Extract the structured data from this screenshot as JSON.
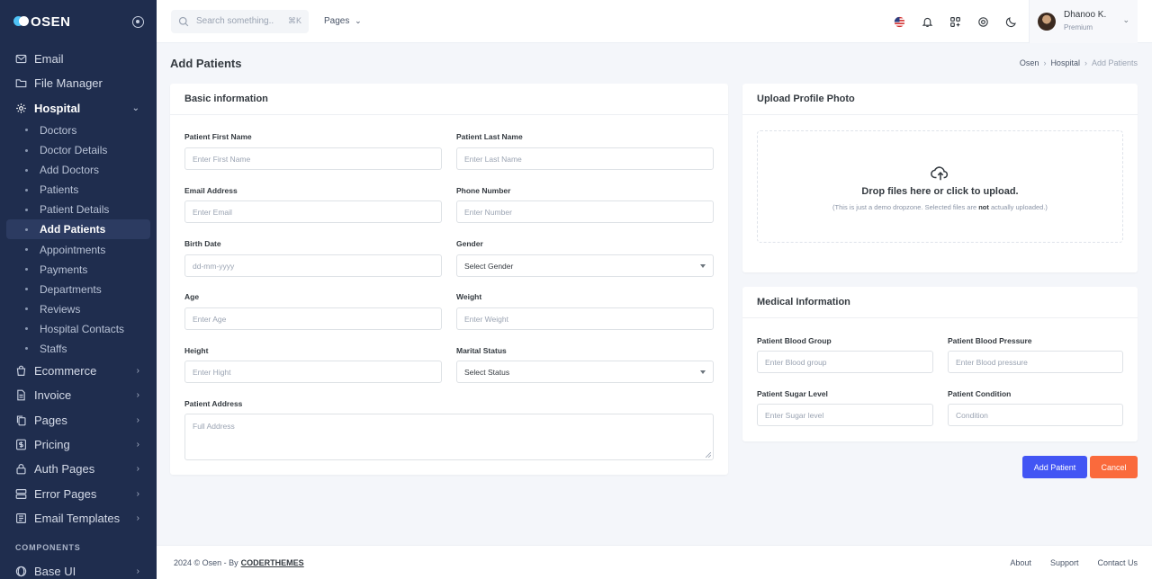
{
  "brand": {
    "name": "OSEN"
  },
  "sidebar": {
    "items": [
      {
        "label": "Email",
        "icon": "mail-icon"
      },
      {
        "label": "File Manager",
        "icon": "folder-icon"
      },
      {
        "label": "Hospital",
        "icon": "gear-icon"
      }
    ],
    "hospital_sub": [
      "Doctors",
      "Doctor Details",
      "Add Doctors",
      "Patients",
      "Patient Details",
      "Add Patients",
      "Appointments",
      "Payments",
      "Departments",
      "Reviews",
      "Hospital Contacts",
      "Staffs"
    ],
    "items2": [
      {
        "label": "Ecommerce",
        "icon": "shopping-bag-icon"
      },
      {
        "label": "Invoice",
        "icon": "file-text-icon"
      },
      {
        "label": "Pages",
        "icon": "copy-icon"
      },
      {
        "label": "Pricing",
        "icon": "dollar-icon"
      },
      {
        "label": "Auth Pages",
        "icon": "lock-icon"
      },
      {
        "label": "Error Pages",
        "icon": "server-icon"
      },
      {
        "label": "Email Templates",
        "icon": "template-icon"
      }
    ],
    "section_components": "COMPONENTS",
    "items3": [
      {
        "label": "Base UI",
        "icon": "globe-icon"
      }
    ]
  },
  "topbar": {
    "search_placeholder": "Search something..",
    "search_kbd": "⌘K",
    "pages_label": "Pages",
    "user": {
      "name": "Dhanoo K.",
      "role": "Premium"
    }
  },
  "page": {
    "title": "Add Patients",
    "breadcrumb": [
      "Osen",
      "Hospital",
      "Add Patients"
    ]
  },
  "basic": {
    "title": "Basic information",
    "first_name": {
      "label": "Patient First Name",
      "placeholder": "Enter First Name"
    },
    "last_name": {
      "label": "Patient Last Name",
      "placeholder": "Enter Last Name"
    },
    "email": {
      "label": "Email Address",
      "placeholder": "Enter Email"
    },
    "phone": {
      "label": "Phone Number",
      "placeholder": "Enter Number"
    },
    "birth": {
      "label": "Birth Date",
      "placeholder": "dd-mm-yyyy"
    },
    "gender": {
      "label": "Gender",
      "value": "Select Gender"
    },
    "age": {
      "label": "Age",
      "placeholder": "Enter Age"
    },
    "weight": {
      "label": "Weight",
      "placeholder": "Enter Weight"
    },
    "height": {
      "label": "Height",
      "placeholder": "Enter Hight"
    },
    "marital": {
      "label": "Marital Status",
      "value": "Select Status"
    },
    "address": {
      "label": "Patient Address",
      "placeholder": "Full Address"
    }
  },
  "upload": {
    "title": "Upload Profile Photo",
    "drop_title": "Drop files here or click to upload.",
    "drop_sub_pre": "(This is just a demo dropzone. Selected files are ",
    "drop_sub_bold": "not",
    "drop_sub_post": " actually uploaded.)"
  },
  "medical": {
    "title": "Medical Information",
    "blood_group": {
      "label": "Patient Blood Group",
      "placeholder": "Enter Blood group"
    },
    "blood_pressure": {
      "label": "Patient Blood Pressure",
      "placeholder": "Enter Blood pressure"
    },
    "sugar": {
      "label": "Patient Sugar Level",
      "placeholder": "Enter Sugar level"
    },
    "condition": {
      "label": "Patient Condition",
      "placeholder": "Condition"
    }
  },
  "actions": {
    "add": "Add Patient",
    "cancel": "Cancel"
  },
  "colors": {
    "primary": "#4255f4",
    "danger": "#fa6a3c",
    "sidebar": "#1f2d4e"
  },
  "footer": {
    "copy": "2024 © Osen - By",
    "brand": "CODERTHEMES",
    "links": [
      "About",
      "Support",
      "Contact Us"
    ]
  }
}
